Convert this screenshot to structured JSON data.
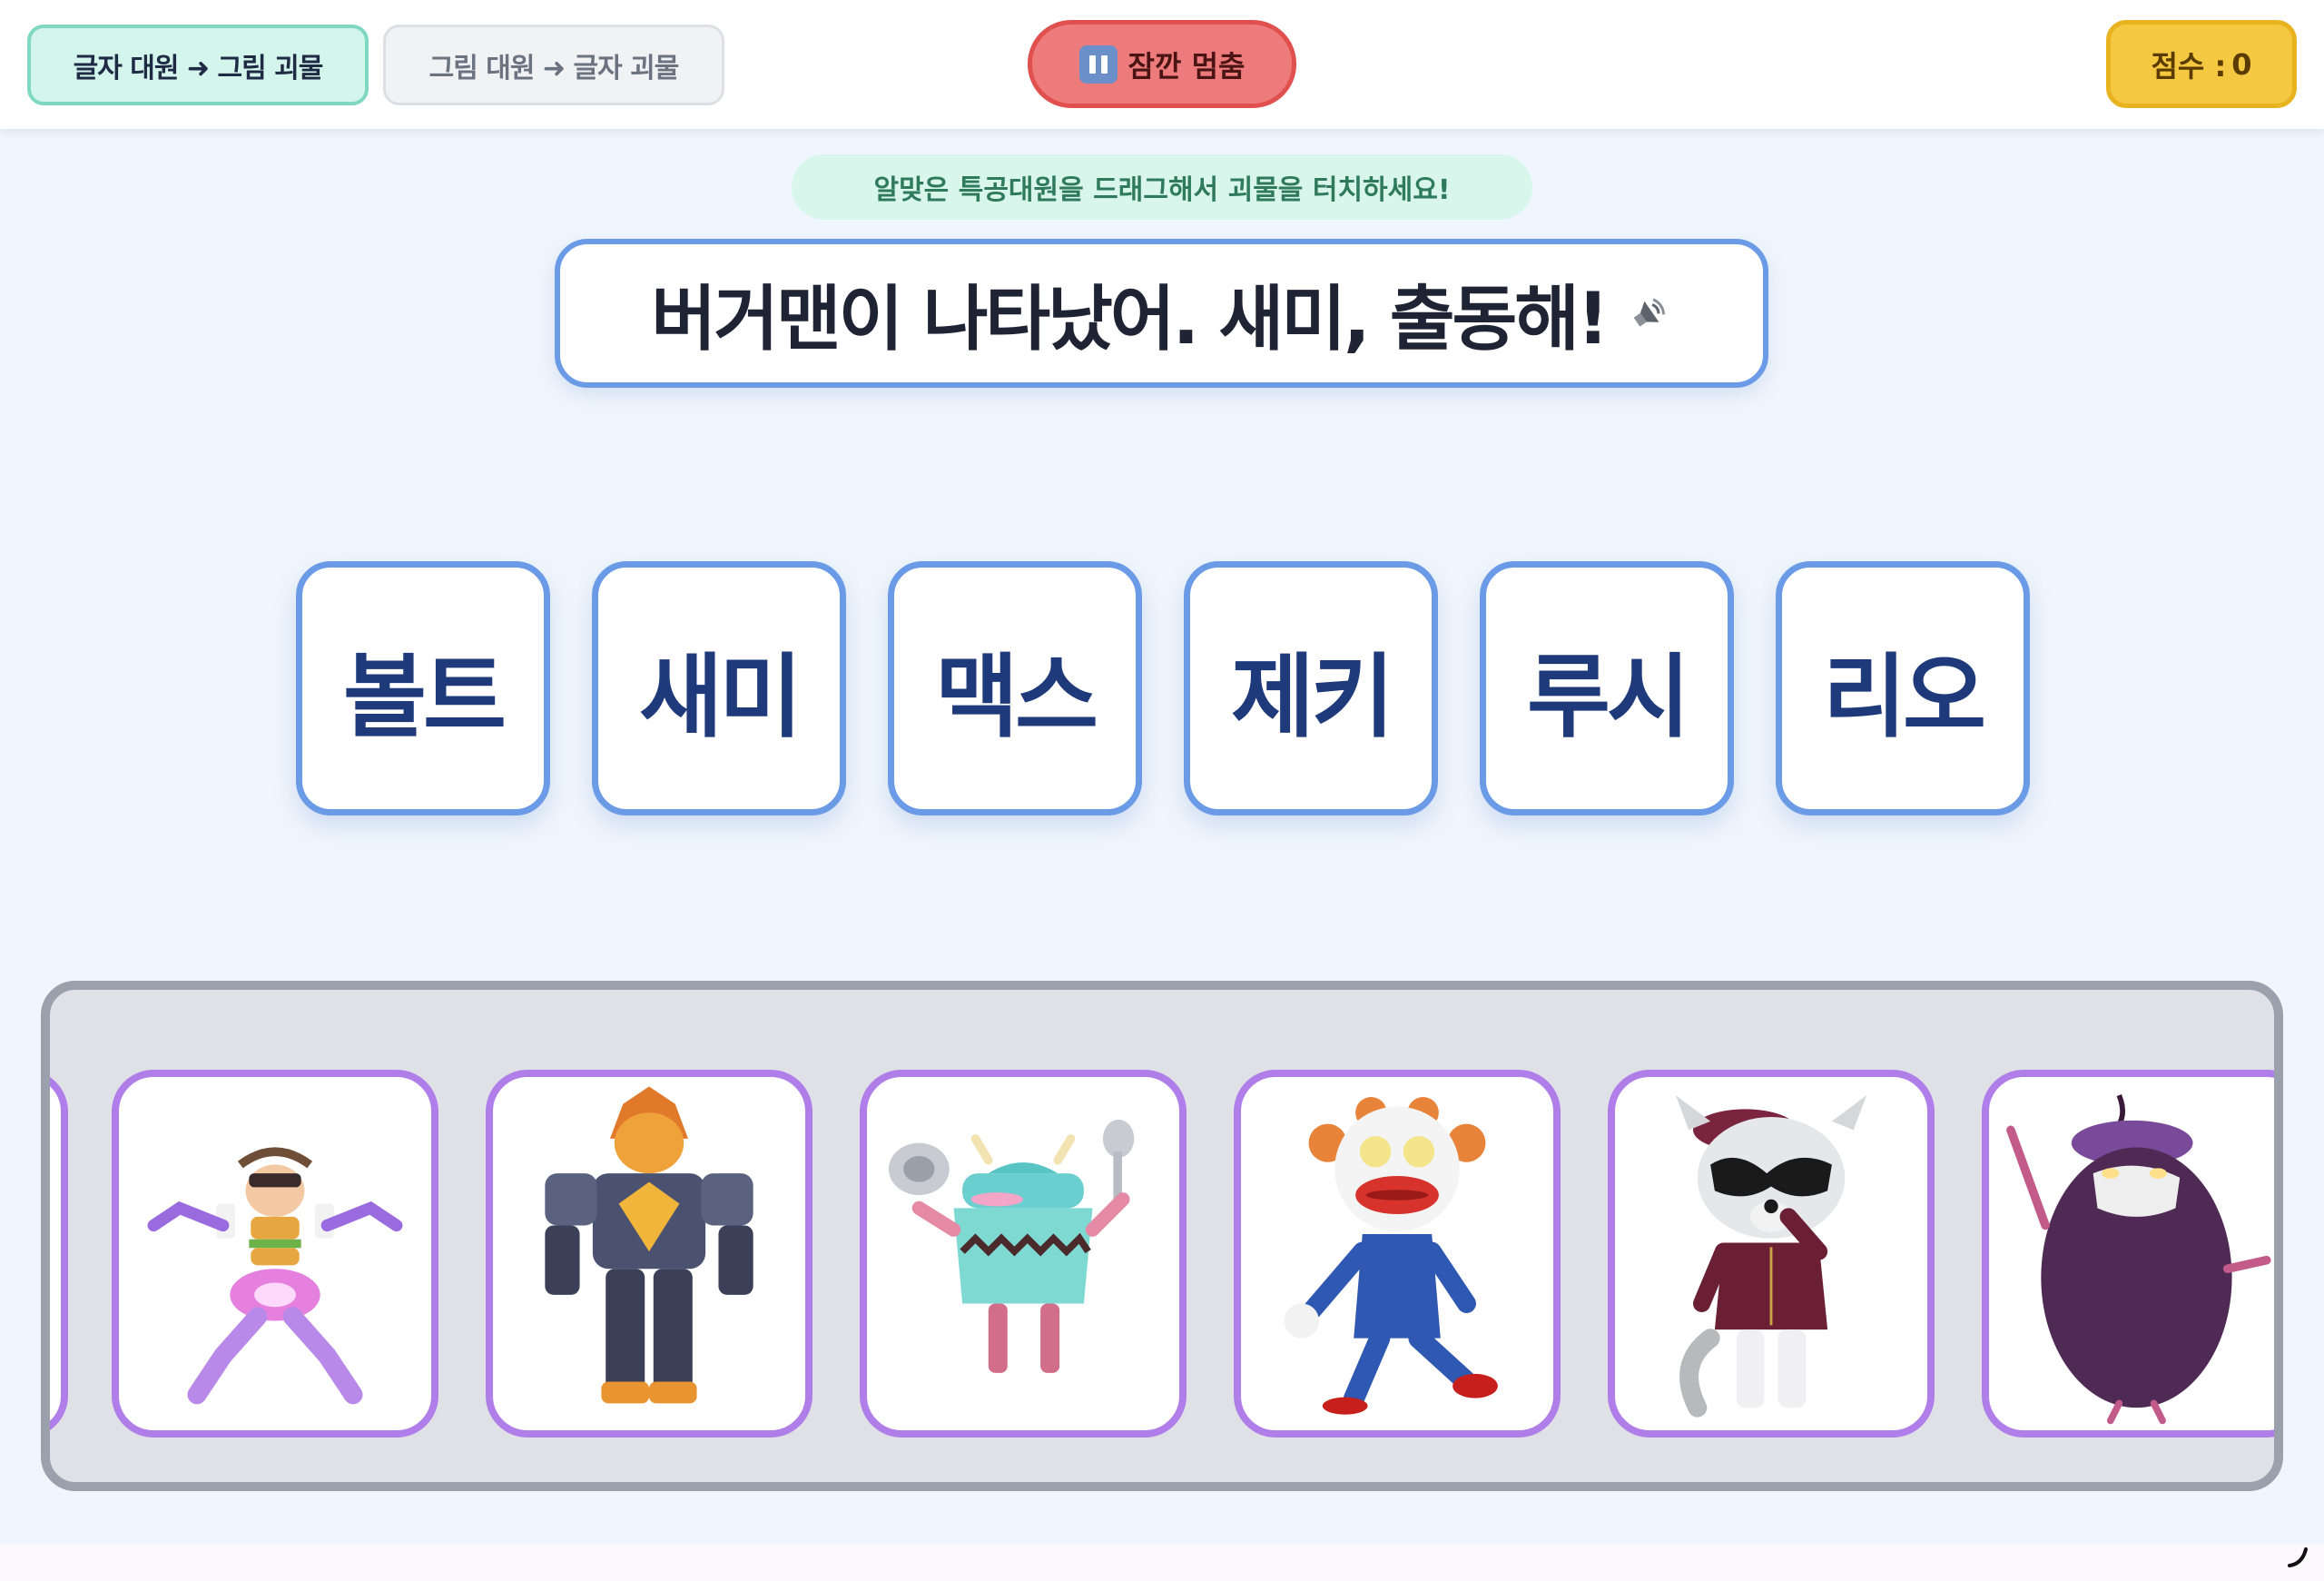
{
  "header": {
    "mode_text_to_image": "글자 대원 ➜ 그림 괴물",
    "mode_image_to_text": "그림 대원 ➜ 글자 괴물",
    "pause_label": "잠깐 멈춤",
    "score_label": "점수 :",
    "score_value": "0"
  },
  "hint": "알맞은 특공대원을 드래그해서 괴물을 터치하세요!",
  "prompt": {
    "text": "버거맨이 나타났어. 새미, 출동해!",
    "speaker_icon": "speaker-icon"
  },
  "word_cards": [
    "볼트",
    "새미",
    "맥스",
    "제키",
    "루시",
    "리오"
  ],
  "monsters": [
    {
      "icon": "burger-man-monster"
    },
    {
      "icon": "armored-lion-robot-monster"
    },
    {
      "icon": "pot-monster"
    },
    {
      "icon": "clown-monster"
    },
    {
      "icon": "raccoon-officer-monster"
    },
    {
      "icon": "eggplant-monster"
    }
  ],
  "colors": {
    "accent_blue": "#6b9ae6",
    "monster_border": "#b07ee8",
    "pause_red": "#ee7b7b",
    "score_yellow": "#f5c842",
    "active_mode_mint": "#d4f5ec"
  }
}
